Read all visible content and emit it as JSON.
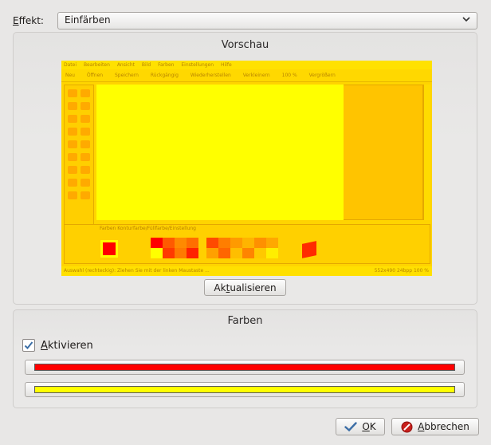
{
  "effect": {
    "label_mnemonic": "E",
    "label_rest": "ffekt:",
    "selected": "Einfärben"
  },
  "preview": {
    "title": "Vorschau",
    "menu": [
      "Datei",
      "Bearbeiten",
      "Ansicht",
      "Bild",
      "Farben",
      "Einstellungen",
      "Hilfe"
    ],
    "toolbar": [
      "Neu",
      "Öffnen",
      "Speichern",
      "Rückgängig",
      "Wiederherstellen",
      "Verkleinern",
      "100 %",
      "Vergrößern"
    ],
    "panel_label": "Farben  Konturfarbe/Füllfarbe/Einstellung",
    "status_left": "Auswahl (rechteckig): Ziehen Sie mit der linken Maustaste ...",
    "status_right": "552x490     24bpp   100 %",
    "refresh_pre": "Ak",
    "refresh_mnemonic": "t",
    "refresh_post": "ualisieren"
  },
  "colors_group": {
    "title": "Farben",
    "activate_mnemonic": "A",
    "activate_rest": "ktivieren",
    "activate_checked": true,
    "color1": "#ff0000",
    "color2": "#ffff00"
  },
  "buttons": {
    "ok_mnemonic": "O",
    "ok_rest": "K",
    "cancel_mnemonic": "A",
    "cancel_rest": "bbrechen"
  },
  "icons": {
    "ok": "checkmark-icon",
    "cancel": "cancel-icon",
    "dropdown": "chevron-down-icon"
  }
}
